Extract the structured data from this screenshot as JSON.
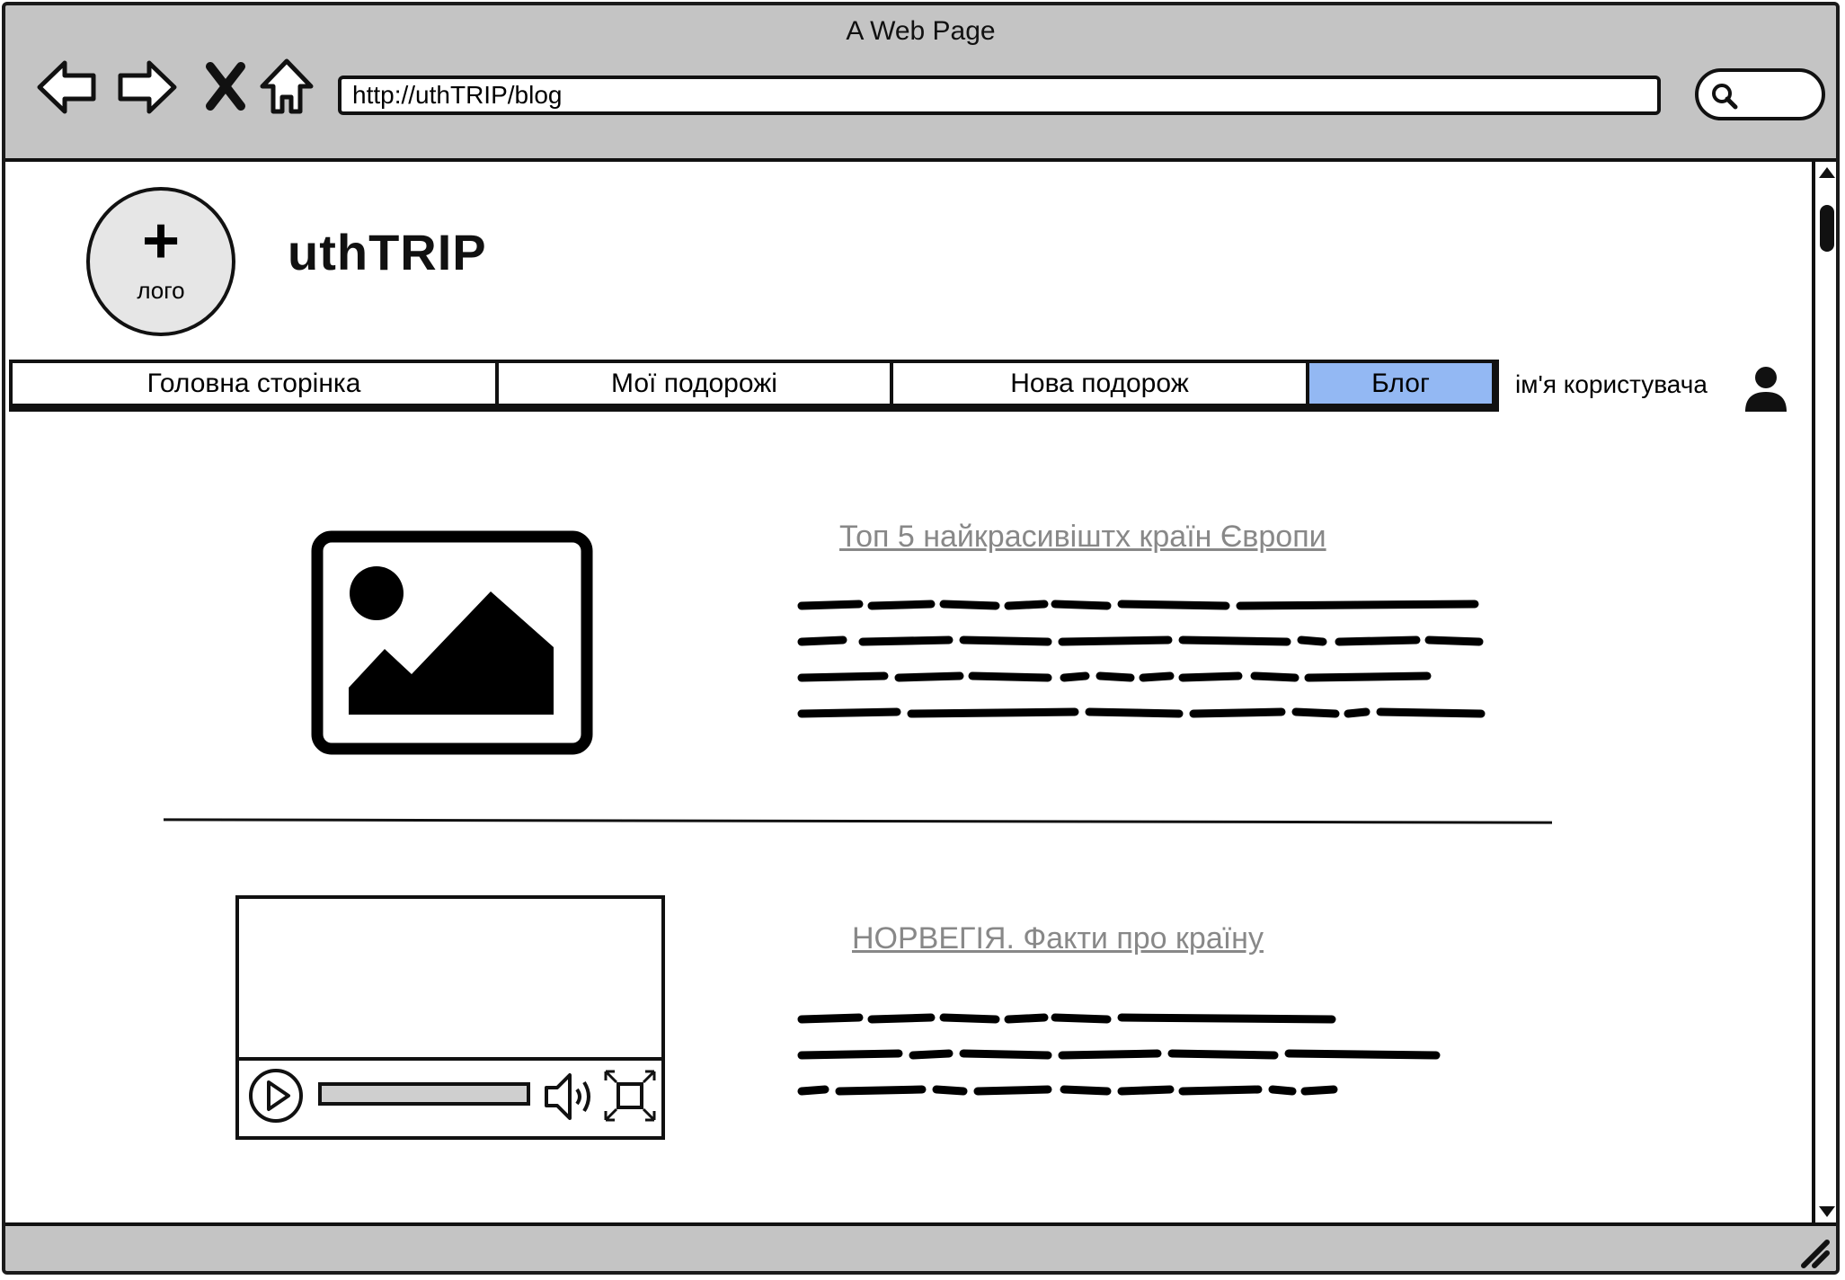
{
  "window": {
    "title": "A Web Page",
    "url": "http://uthTRIP/blog"
  },
  "header": {
    "logo_label": "лого",
    "site_title": "uthTRIP"
  },
  "nav": {
    "tabs": [
      {
        "label": "Головна сторінка",
        "active": false
      },
      {
        "label": "Мої подорожі",
        "active": false
      },
      {
        "label": "Нова подорож",
        "active": false
      },
      {
        "label": "Блог",
        "active": true
      }
    ],
    "active_color": "#93b8f3",
    "user_name": "ім'я користувача"
  },
  "posts": [
    {
      "title": "Топ 5 найкрасивіштх країн Європи",
      "media": "image-placeholder-icon"
    },
    {
      "title": "НОРВЕГІЯ. Факти про країну",
      "media": "video-player"
    }
  ],
  "icons": {
    "back": "arrow-left-icon",
    "forward": "arrow-right-icon",
    "stop": "close-icon",
    "home": "home-icon",
    "search": "search-icon",
    "user": "user-icon",
    "play": "play-icon",
    "volume": "volume-icon",
    "fullscreen": "fullscreen-icon",
    "resize": "resize-grip-icon"
  }
}
